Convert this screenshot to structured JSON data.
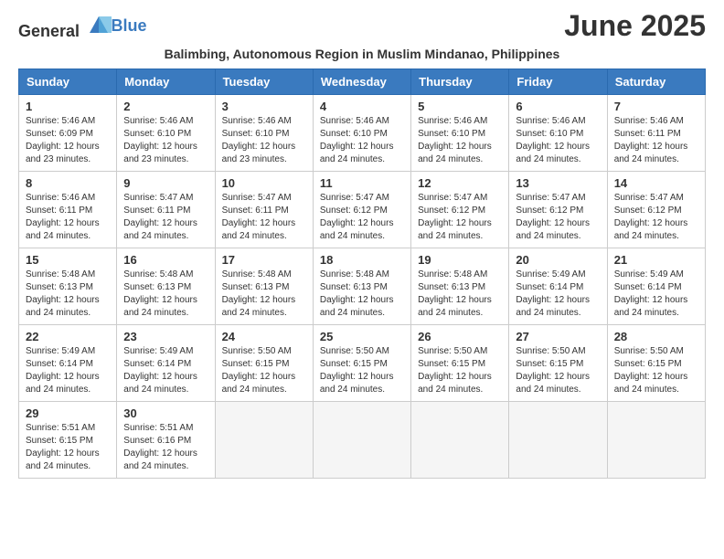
{
  "header": {
    "logo_general": "General",
    "logo_blue": "Blue",
    "month_title": "June 2025",
    "subtitle": "Balimbing, Autonomous Region in Muslim Mindanao, Philippines"
  },
  "weekdays": [
    "Sunday",
    "Monday",
    "Tuesday",
    "Wednesday",
    "Thursday",
    "Friday",
    "Saturday"
  ],
  "weeks": [
    [
      {
        "day": "1",
        "info": "Sunrise: 5:46 AM\nSunset: 6:09 PM\nDaylight: 12 hours and 23 minutes."
      },
      {
        "day": "2",
        "info": "Sunrise: 5:46 AM\nSunset: 6:10 PM\nDaylight: 12 hours and 23 minutes."
      },
      {
        "day": "3",
        "info": "Sunrise: 5:46 AM\nSunset: 6:10 PM\nDaylight: 12 hours and 23 minutes."
      },
      {
        "day": "4",
        "info": "Sunrise: 5:46 AM\nSunset: 6:10 PM\nDaylight: 12 hours and 24 minutes."
      },
      {
        "day": "5",
        "info": "Sunrise: 5:46 AM\nSunset: 6:10 PM\nDaylight: 12 hours and 24 minutes."
      },
      {
        "day": "6",
        "info": "Sunrise: 5:46 AM\nSunset: 6:10 PM\nDaylight: 12 hours and 24 minutes."
      },
      {
        "day": "7",
        "info": "Sunrise: 5:46 AM\nSunset: 6:11 PM\nDaylight: 12 hours and 24 minutes."
      }
    ],
    [
      {
        "day": "8",
        "info": "Sunrise: 5:46 AM\nSunset: 6:11 PM\nDaylight: 12 hours and 24 minutes."
      },
      {
        "day": "9",
        "info": "Sunrise: 5:47 AM\nSunset: 6:11 PM\nDaylight: 12 hours and 24 minutes."
      },
      {
        "day": "10",
        "info": "Sunrise: 5:47 AM\nSunset: 6:11 PM\nDaylight: 12 hours and 24 minutes."
      },
      {
        "day": "11",
        "info": "Sunrise: 5:47 AM\nSunset: 6:12 PM\nDaylight: 12 hours and 24 minutes."
      },
      {
        "day": "12",
        "info": "Sunrise: 5:47 AM\nSunset: 6:12 PM\nDaylight: 12 hours and 24 minutes."
      },
      {
        "day": "13",
        "info": "Sunrise: 5:47 AM\nSunset: 6:12 PM\nDaylight: 12 hours and 24 minutes."
      },
      {
        "day": "14",
        "info": "Sunrise: 5:47 AM\nSunset: 6:12 PM\nDaylight: 12 hours and 24 minutes."
      }
    ],
    [
      {
        "day": "15",
        "info": "Sunrise: 5:48 AM\nSunset: 6:13 PM\nDaylight: 12 hours and 24 minutes."
      },
      {
        "day": "16",
        "info": "Sunrise: 5:48 AM\nSunset: 6:13 PM\nDaylight: 12 hours and 24 minutes."
      },
      {
        "day": "17",
        "info": "Sunrise: 5:48 AM\nSunset: 6:13 PM\nDaylight: 12 hours and 24 minutes."
      },
      {
        "day": "18",
        "info": "Sunrise: 5:48 AM\nSunset: 6:13 PM\nDaylight: 12 hours and 24 minutes."
      },
      {
        "day": "19",
        "info": "Sunrise: 5:48 AM\nSunset: 6:13 PM\nDaylight: 12 hours and 24 minutes."
      },
      {
        "day": "20",
        "info": "Sunrise: 5:49 AM\nSunset: 6:14 PM\nDaylight: 12 hours and 24 minutes."
      },
      {
        "day": "21",
        "info": "Sunrise: 5:49 AM\nSunset: 6:14 PM\nDaylight: 12 hours and 24 minutes."
      }
    ],
    [
      {
        "day": "22",
        "info": "Sunrise: 5:49 AM\nSunset: 6:14 PM\nDaylight: 12 hours and 24 minutes."
      },
      {
        "day": "23",
        "info": "Sunrise: 5:49 AM\nSunset: 6:14 PM\nDaylight: 12 hours and 24 minutes."
      },
      {
        "day": "24",
        "info": "Sunrise: 5:50 AM\nSunset: 6:15 PM\nDaylight: 12 hours and 24 minutes."
      },
      {
        "day": "25",
        "info": "Sunrise: 5:50 AM\nSunset: 6:15 PM\nDaylight: 12 hours and 24 minutes."
      },
      {
        "day": "26",
        "info": "Sunrise: 5:50 AM\nSunset: 6:15 PM\nDaylight: 12 hours and 24 minutes."
      },
      {
        "day": "27",
        "info": "Sunrise: 5:50 AM\nSunset: 6:15 PM\nDaylight: 12 hours and 24 minutes."
      },
      {
        "day": "28",
        "info": "Sunrise: 5:50 AM\nSunset: 6:15 PM\nDaylight: 12 hours and 24 minutes."
      }
    ],
    [
      {
        "day": "29",
        "info": "Sunrise: 5:51 AM\nSunset: 6:15 PM\nDaylight: 12 hours and 24 minutes."
      },
      {
        "day": "30",
        "info": "Sunrise: 5:51 AM\nSunset: 6:16 PM\nDaylight: 12 hours and 24 minutes."
      },
      {
        "day": "",
        "info": ""
      },
      {
        "day": "",
        "info": ""
      },
      {
        "day": "",
        "info": ""
      },
      {
        "day": "",
        "info": ""
      },
      {
        "day": "",
        "info": ""
      }
    ]
  ]
}
